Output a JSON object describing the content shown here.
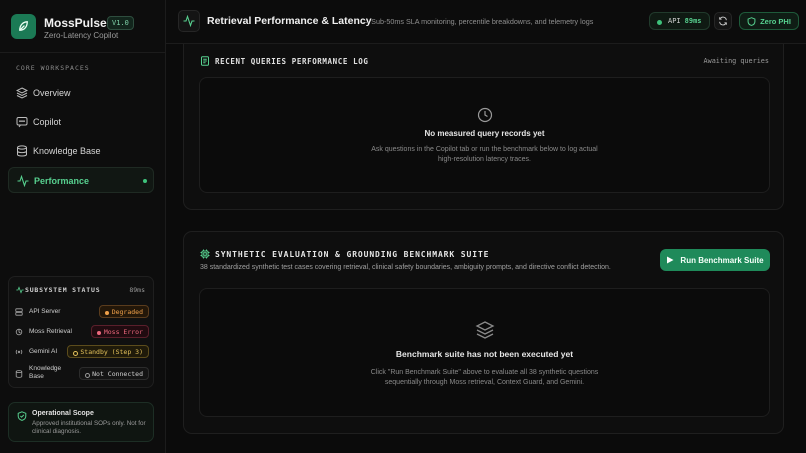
{
  "brand": {
    "name": "MossPulse",
    "version": "V1.0",
    "subtitle": "Zero-Latency Copilot"
  },
  "sidebar": {
    "section_title": "CORE WORKSPACES",
    "items": [
      {
        "label": "Overview",
        "icon": "layers-icon",
        "active": false
      },
      {
        "label": "Copilot",
        "icon": "chat-icon",
        "active": false
      },
      {
        "label": "Knowledge Base",
        "icon": "database-icon",
        "active": false
      },
      {
        "label": "Performance",
        "icon": "activity-icon",
        "active": true
      }
    ],
    "status": {
      "title": "SUBSYSTEM STATUS",
      "latency": "89ms",
      "rows": [
        {
          "name": "API Server",
          "icon": "server-icon",
          "badge": "Degraded",
          "color": "#f0a14a"
        },
        {
          "name": "Moss Retrieval",
          "icon": "retrieval-icon",
          "badge": "Moss Error",
          "color": "#ef6a7e"
        },
        {
          "name": "Gemini AI",
          "icon": "broadcast-icon",
          "badge": "Standby (Step 3)",
          "color": "#e4c25c"
        },
        {
          "name": "Knowledge Base",
          "icon": "database-icon",
          "badge": "Not Connected",
          "color": "#9a9a9a"
        }
      ]
    },
    "scope": {
      "title": "Operational Scope",
      "text": "Approved institutional SOPs only. Not for clinical diagnosis."
    }
  },
  "header": {
    "title": "Retrieval Performance & Latency",
    "subtitle": "— Sub-50ms SLA monitoring, percentile breakdowns, and telemetry logs",
    "api_label": "API",
    "api_value": "89ms",
    "phi_label": "Zero PHI"
  },
  "queries_log": {
    "title": "RECENT QUERIES PERFORMANCE LOG",
    "status": "Awaiting queries",
    "empty_title": "No measured query records yet",
    "empty_text_1": "Ask questions in the Copilot tab or run the benchmark below to log actual",
    "empty_text_2": "high-resolution latency traces."
  },
  "benchmark": {
    "title": "SYNTHETIC EVALUATION & GROUNDING BENCHMARK SUITE",
    "description": "38 standardized synthetic test cases covering retrieval, clinical safety boundaries, ambiguity prompts, and directive conflict detection.",
    "run_label": "Run Benchmark Suite",
    "empty_title": "Benchmark suite has not been executed yet",
    "empty_text_1": "Click \"Run Benchmark Suite\" above to evaluate all 38 synthetic questions",
    "empty_text_2": "sequentially through Moss retrieval, Context Guard, and Gemini."
  },
  "colors": {
    "accent": "#3ec27b",
    "button": "#1f8a5a",
    "background": "#0b0b0b"
  }
}
